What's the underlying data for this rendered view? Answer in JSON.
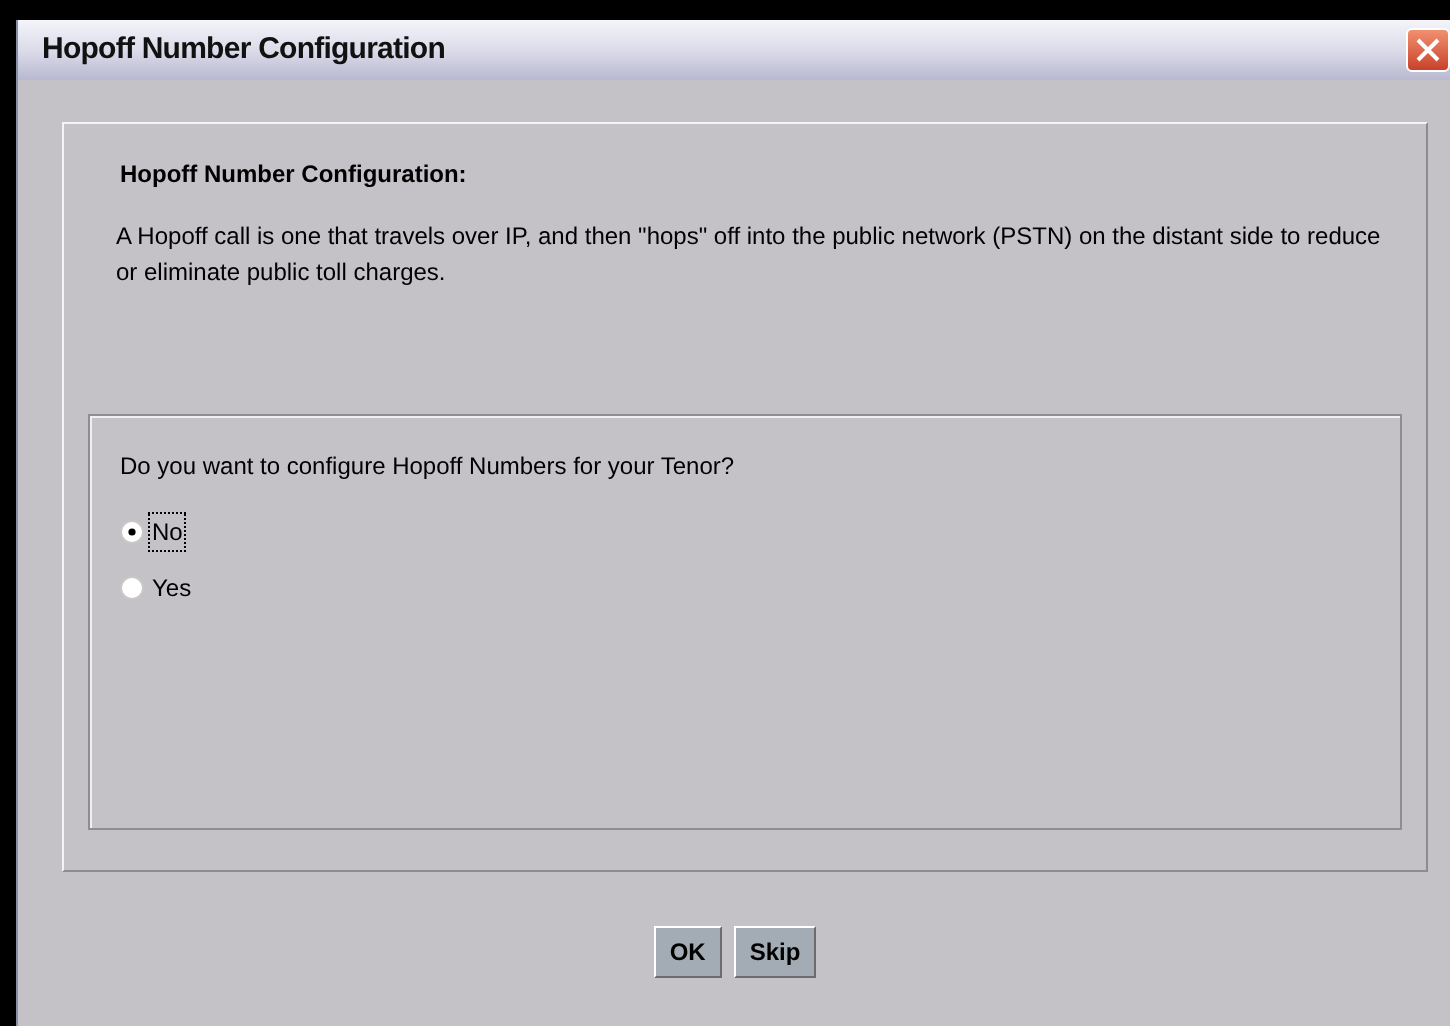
{
  "window": {
    "title": "Hopoff Number Configuration"
  },
  "header": {
    "heading": "Hopoff Number Configuration:",
    "description": "A Hopoff call is one that travels over IP, and then \"hops\" off into the public network (PSTN) on the distant side to reduce or eliminate public toll charges."
  },
  "question": {
    "prompt": "Do you want to configure Hopoff Numbers for your Tenor?",
    "options": [
      {
        "label": "No",
        "selected": true
      },
      {
        "label": "Yes",
        "selected": false
      }
    ]
  },
  "buttons": [
    "OK",
    "Skip"
  ]
}
